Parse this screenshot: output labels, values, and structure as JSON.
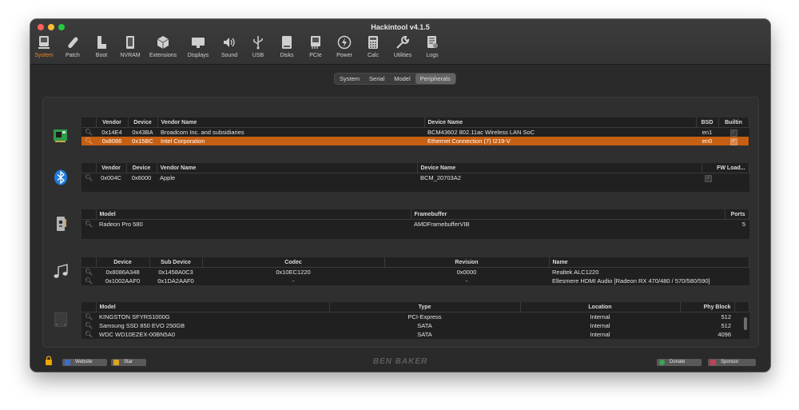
{
  "window": {
    "title": "Hackintool v4.1.5"
  },
  "toolbar": {
    "items": [
      {
        "label": "System",
        "icon": "system-icon"
      },
      {
        "label": "Patch",
        "icon": "patch-icon"
      },
      {
        "label": "Boot",
        "icon": "boot-icon"
      },
      {
        "label": "NVRAM",
        "icon": "nvram-icon"
      },
      {
        "label": "Extensions",
        "icon": "extensions-icon"
      },
      {
        "label": "Displays",
        "icon": "displays-icon"
      },
      {
        "label": "Sound",
        "icon": "sound-icon"
      },
      {
        "label": "USB",
        "icon": "usb-icon"
      },
      {
        "label": "Disks",
        "icon": "disks-icon"
      },
      {
        "label": "PCIe",
        "icon": "pcie-icon"
      },
      {
        "label": "Power",
        "icon": "power-icon"
      },
      {
        "label": "Calc",
        "icon": "calc-icon"
      },
      {
        "label": "Utilities",
        "icon": "utilities-icon"
      },
      {
        "label": "Logs",
        "icon": "logs-icon"
      }
    ],
    "active": "System"
  },
  "tabs": {
    "items": [
      "System",
      "Serial",
      "Model",
      "Peripherals"
    ],
    "selected": "Peripherals"
  },
  "network": {
    "headers": [
      "Vendor",
      "Device",
      "Vendor Name",
      "Device Name",
      "BSD",
      "Builtin"
    ],
    "rows": [
      {
        "vendor": "0x14E4",
        "device": "0x43BA",
        "vendor_name": "Broadcom Inc. and subsidiaries",
        "device_name": "BCM43602 802.11ac Wireless LAN SoC",
        "bsd": "en1",
        "builtin": true,
        "selected": false
      },
      {
        "vendor": "0x8086",
        "device": "0x15BC",
        "vendor_name": "Intel Corporation",
        "device_name": "Ethernet Connection (7) I219-V",
        "bsd": "en0",
        "builtin": true,
        "selected": true
      }
    ]
  },
  "bluetooth": {
    "headers": [
      "Vendor",
      "Device",
      "Vendor Name",
      "Device Name",
      "FW Load..."
    ],
    "rows": [
      {
        "vendor": "0x004C",
        "device": "0x6000",
        "vendor_name": "Apple",
        "device_name": "BCM_20703A2",
        "fw_load": true
      }
    ]
  },
  "graphics": {
    "headers": [
      "Model",
      "Framebuffer",
      "Ports"
    ],
    "rows": [
      {
        "model": "Radeon Pro 580",
        "framebuffer": "AMDFramebufferVIB",
        "ports": "5"
      }
    ]
  },
  "audio": {
    "headers": [
      "Device",
      "Sub Device",
      "Codec",
      "Revision",
      "Name"
    ],
    "rows": [
      {
        "device": "0x8086A348",
        "sub_device": "0x1458A0C3",
        "codec": "0x10EC1220",
        "revision": "0x0000",
        "name": "Realtek ALC1220"
      },
      {
        "device": "0x1002AAF0",
        "sub_device": "0x1DA2AAF0",
        "codec": "-",
        "revision": "-",
        "name": "Ellesmere HDMI Audio [Radeon RX 470/480 / 570/580/590]"
      }
    ]
  },
  "storage": {
    "headers": [
      "Model",
      "Type",
      "Location",
      "Phy Block"
    ],
    "rows": [
      {
        "model": "KINGSTON SFYRS1000G",
        "type": "PCI-Express",
        "location": "Internal",
        "phy_block": "512"
      },
      {
        "model": "Samsung SSD 850 EVO 250GB",
        "type": "SATA",
        "location": "Internal",
        "phy_block": "512"
      },
      {
        "model": "WDC WD10EZEX-00BN5A0",
        "type": "SATA",
        "location": "Internal",
        "phy_block": "4096"
      }
    ]
  },
  "footer": {
    "website_label": "Website",
    "star_label": "Star",
    "brand": "BEN BAKER",
    "donate_label": "Donate",
    "sponsor_label": "Sponsor"
  },
  "colors": {
    "accent": "#c55f14",
    "selected_tab": "#e8872a"
  }
}
